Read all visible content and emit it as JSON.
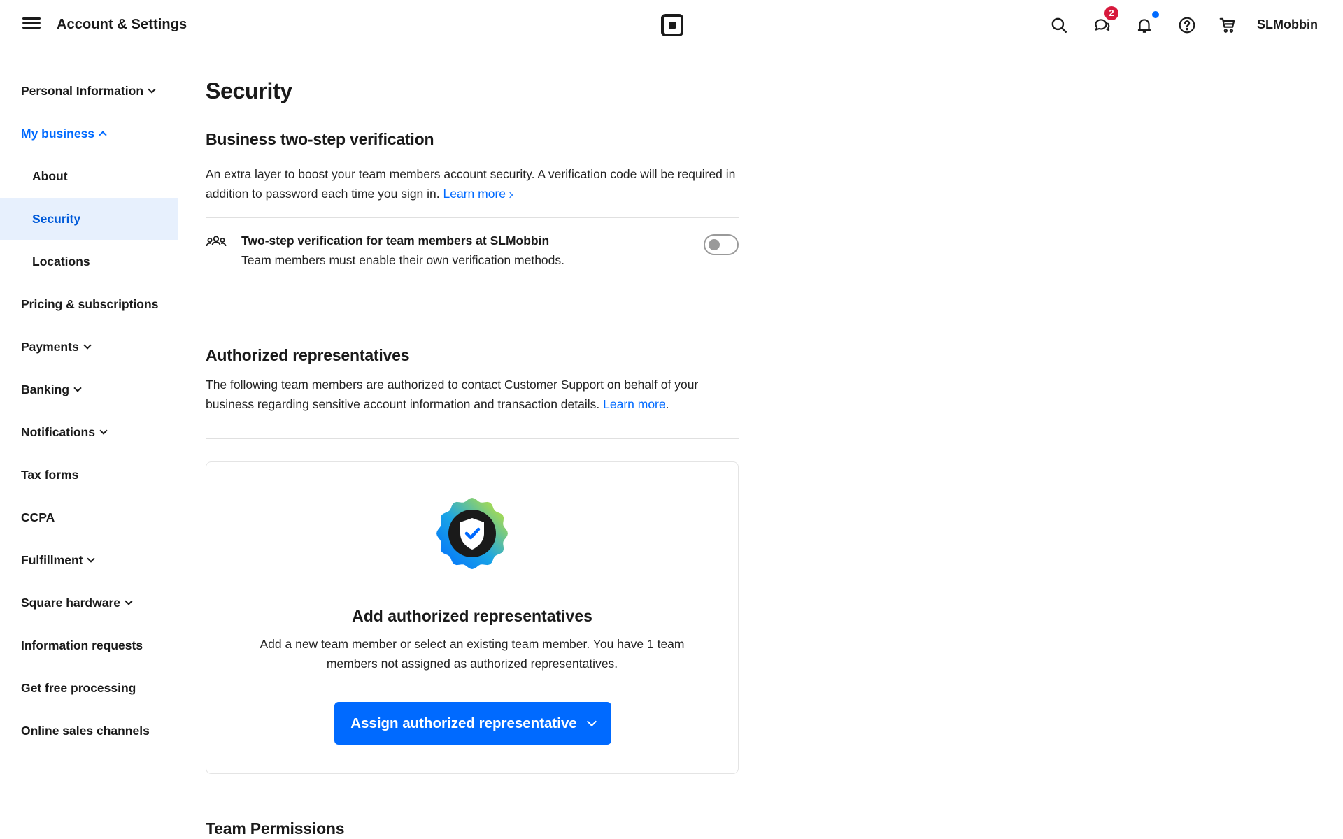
{
  "header": {
    "title": "Account & Settings",
    "username": "SLMobbin",
    "messages_badge": "2",
    "brand_color": "#006aff",
    "badge_color": "#d7193c",
    "icons": [
      "menu-icon",
      "square-logo-icon",
      "search-icon",
      "messages-icon",
      "bell-icon",
      "help-icon",
      "cart-icon"
    ]
  },
  "sidebar": {
    "items": [
      {
        "label": "Personal Information",
        "expandable": true
      },
      {
        "label": "My business",
        "expanded": true
      },
      {
        "label": "About"
      },
      {
        "label": "Security",
        "active": true
      },
      {
        "label": "Locations"
      },
      {
        "label": "Pricing & subscriptions"
      },
      {
        "label": "Payments",
        "expandable": true
      },
      {
        "label": "Banking",
        "expandable": true
      },
      {
        "label": "Notifications",
        "expandable": true
      },
      {
        "label": "Tax forms"
      },
      {
        "label": "CCPA"
      },
      {
        "label": "Fulfillment",
        "expandable": true
      },
      {
        "label": "Square hardware",
        "expandable": true
      },
      {
        "label": "Information requests"
      },
      {
        "label": "Get free processing"
      },
      {
        "label": "Online sales channels"
      }
    ]
  },
  "main": {
    "page_title": "Security",
    "two_step": {
      "heading": "Business two-step verification",
      "description": "An extra layer to boost your team members account security. A verification code will be required in addition to password each time you sign in.",
      "link": "Learn more",
      "setting_title": "Two-step verification for team members at SLMobbin",
      "setting_subtitle": "Team members must enable their own verification methods.",
      "enabled": false
    },
    "authorized": {
      "heading": "Authorized representatives",
      "description": "The following team members are authorized to contact Customer Support on behalf of your business regarding sensitive account information and transaction details.",
      "link": "Learn more",
      "link_suffix": ".",
      "card_title": "Add authorized representatives",
      "card_text": "Add a new team member or select an existing team member. You have 1 team members not assigned as authorized representatives.",
      "button_label": "Assign authorized representative"
    },
    "team_permissions_heading": "Team Permissions"
  }
}
